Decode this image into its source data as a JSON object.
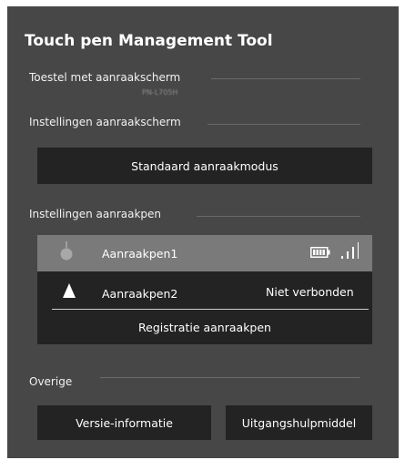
{
  "app": {
    "title": "Touch pen Management Tool"
  },
  "device": {
    "label": "Toestel met aanraakscherm",
    "model": "PN-L705H"
  },
  "screen_settings": {
    "label": "Instellingen aanraakscherm",
    "mode_button": "Standaard aanraakmodus"
  },
  "pen_settings": {
    "label": "Instellingen aanraakpen",
    "pens": [
      {
        "name": "Aanraakpen1",
        "status": ""
      },
      {
        "name": "Aanraakpen2",
        "status": "Niet verbonden"
      }
    ],
    "register_button": "Registratie aanraakpen"
  },
  "other": {
    "label": "Overige",
    "version_button": "Versie-informatie",
    "utility_button": "Uitgangshulpmiddel"
  },
  "colors": {
    "panel": "#474747",
    "button": "#232323",
    "selected_row": "#7a7a7a"
  }
}
